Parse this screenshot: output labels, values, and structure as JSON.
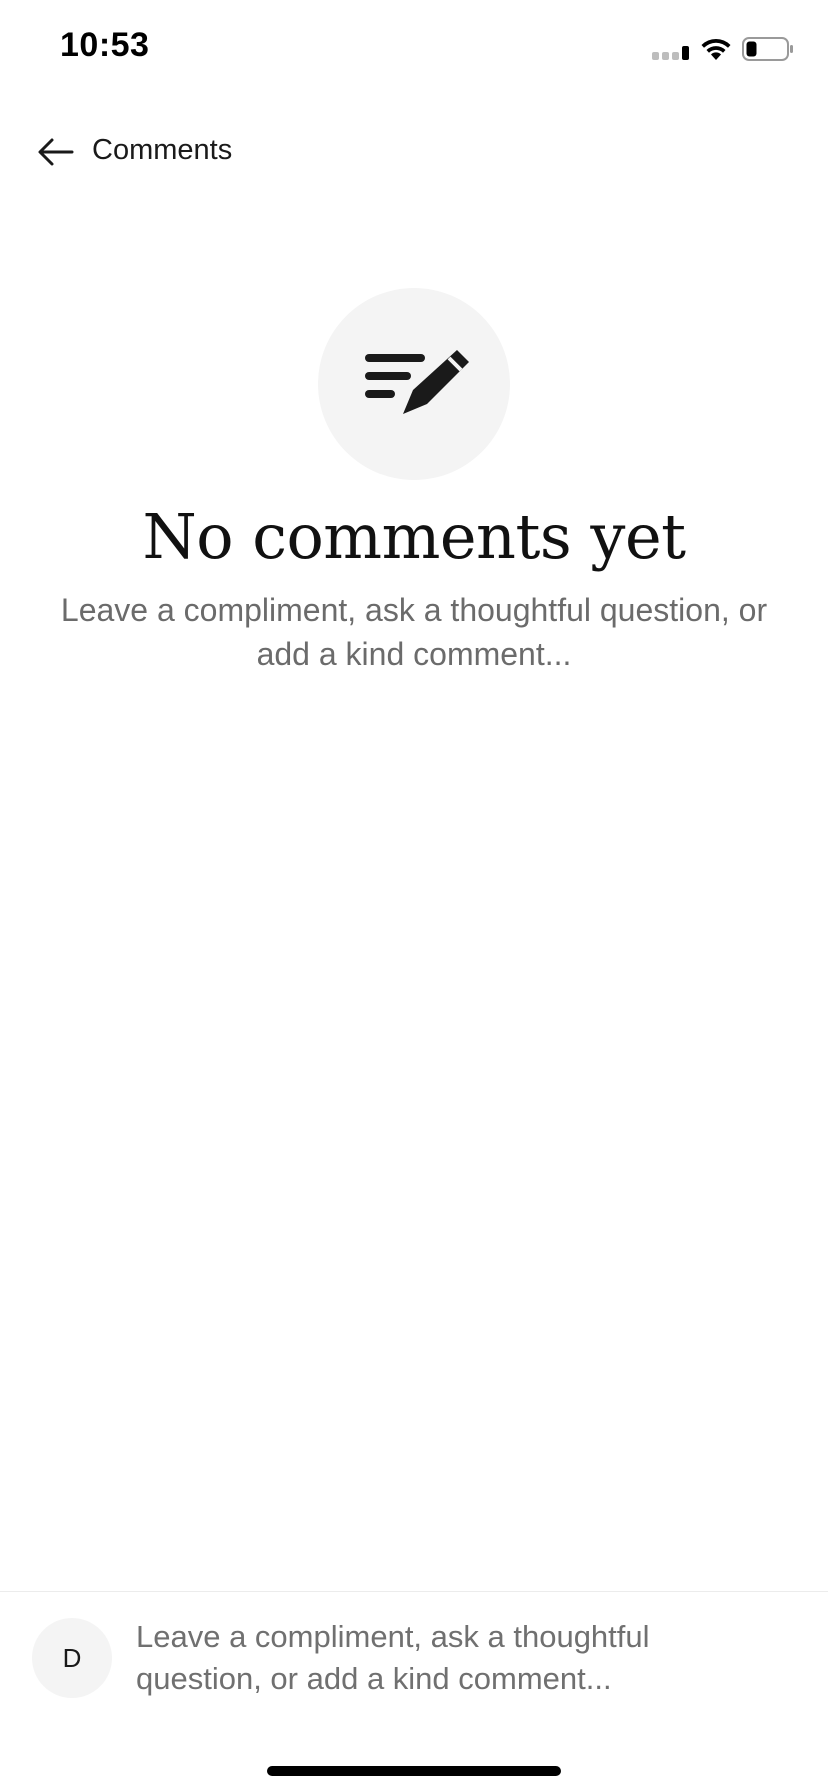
{
  "status_bar": {
    "time": "10:53",
    "icons": [
      "signal-icon",
      "wifi-icon",
      "battery-icon"
    ]
  },
  "header": {
    "title": "Comments",
    "back_icon": "arrow-left-icon"
  },
  "empty_state": {
    "icon": "compose-pencil-icon",
    "title": "No comments yet",
    "subtitle": "Leave a compliment, ask a thoughtful question, or add a kind comment..."
  },
  "composer": {
    "avatar_initial": "D",
    "placeholder": "Leave a compliment, ask a thoughtful question, or add a kind comment..."
  },
  "colors": {
    "background": "#ffffff",
    "text_primary": "#1a1a1a",
    "text_secondary": "#6b6b6b",
    "icon_circle": "#f4f4f4"
  }
}
